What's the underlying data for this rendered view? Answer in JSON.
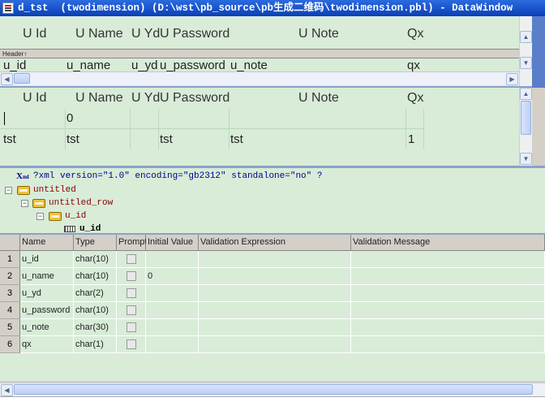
{
  "window": {
    "title": "d_tst  (twodimension) (D:\\wst\\pb_source\\pb生成二维码\\twodimension.pbl) - DataWindow"
  },
  "design_pane": {
    "columns": [
      "U Id",
      "U Name",
      "U Yd",
      "U Password",
      "U Note",
      "Qx"
    ],
    "header_band_label": "Header↑",
    "detail_fields": [
      "u_id",
      "u_name",
      "u_yd",
      "u_password",
      "u_note",
      "qx"
    ]
  },
  "preview_pane": {
    "columns": [
      "U Id",
      "U Name",
      "U Yd",
      "U Password",
      "U Note",
      "Qx"
    ],
    "rows": [
      [
        "",
        "0",
        "",
        "",
        "",
        ""
      ],
      [
        "tst",
        "tst",
        "",
        "tst",
        "tst",
        "1"
      ]
    ]
  },
  "xml_pane": {
    "declaration": "?xml version=\"1.0\" encoding=\"gb2312\" standalone=\"no\" ?",
    "nodes": [
      "untitled",
      "untitled_row",
      "u_id",
      "u_id"
    ]
  },
  "column_grid": {
    "headers": [
      "Name",
      "Type",
      "Prompt",
      "Initial Value",
      "Validation Expression",
      "Validation Message"
    ],
    "rows": [
      {
        "num": "1",
        "name": "u_id",
        "type": "char(10)",
        "initial": ""
      },
      {
        "num": "2",
        "name": "u_name",
        "type": "char(10)",
        "initial": "0"
      },
      {
        "num": "3",
        "name": "u_yd",
        "type": "char(2)",
        "initial": ""
      },
      {
        "num": "4",
        "name": "u_password",
        "type": "char(10)",
        "initial": ""
      },
      {
        "num": "5",
        "name": "u_note",
        "type": "char(30)",
        "initial": ""
      },
      {
        "num": "6",
        "name": "qx",
        "type": "char(1)",
        "initial": ""
      }
    ]
  },
  "icons": {
    "xml-declaration": "xml-declaration-icon",
    "element": "xml-element-icon",
    "attribute": "xml-attribute-icon"
  },
  "colors": {
    "title_bar": "#0a3fb5",
    "pane_background": "#d8ecd8",
    "declaration_text": "#00008b",
    "element_text": "#8b0000"
  }
}
